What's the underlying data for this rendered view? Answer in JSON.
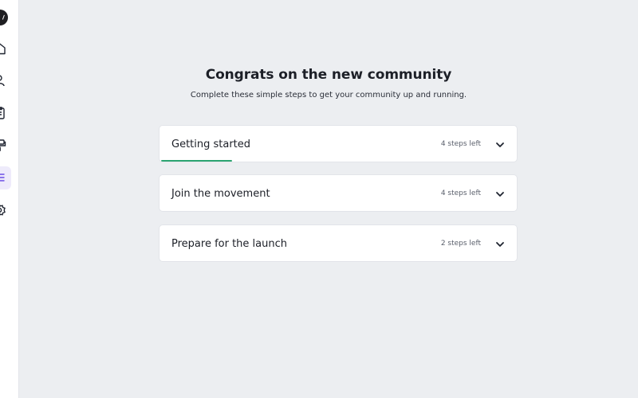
{
  "sidebar": {
    "items": [
      {
        "icon": "home-icon"
      },
      {
        "icon": "members-icon"
      },
      {
        "icon": "clipboard-icon"
      },
      {
        "icon": "paint-roller-icon"
      },
      {
        "icon": "list-icon",
        "active": true
      },
      {
        "icon": "settings-icon"
      }
    ],
    "accent_color": "#6B4EE6"
  },
  "main": {
    "title": "Congrats on the new community",
    "subtitle": "Complete these simple steps to get your community up and running."
  },
  "sections": [
    {
      "title": "Getting started",
      "steps_left": "4 steps left",
      "progress": 0.2
    },
    {
      "title": "Join the movement",
      "steps_left": "4 steps left"
    },
    {
      "title": "Prepare for the launch",
      "steps_left": "2 steps left"
    }
  ],
  "colors": {
    "progress": "#2BA471",
    "background": "#ECEEF1"
  }
}
